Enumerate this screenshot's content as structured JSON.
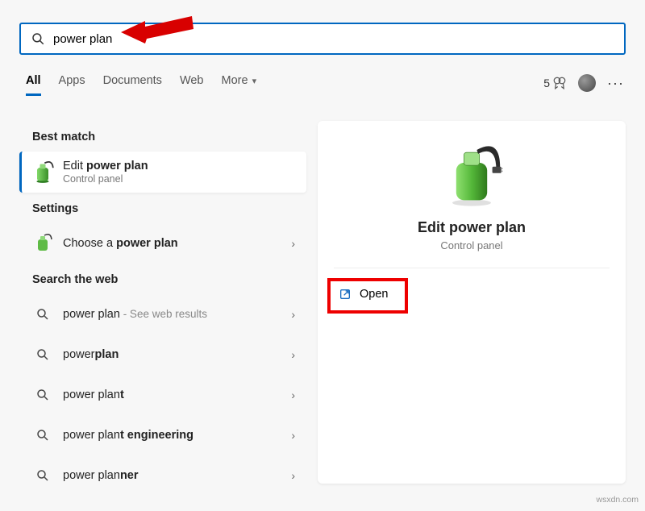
{
  "search": {
    "value": "power plan"
  },
  "tabs": {
    "all": "All",
    "apps": "Apps",
    "documents": "Documents",
    "web": "Web",
    "more": "More"
  },
  "rewards": {
    "count": "5"
  },
  "sections": {
    "best_match": "Best match",
    "settings": "Settings",
    "web": "Search the web"
  },
  "best": {
    "title_pre": "Edit ",
    "title_bold": "power plan",
    "sub": "Control panel"
  },
  "setting": {
    "pre": "Choose a ",
    "bold": "power plan"
  },
  "web_items": [
    {
      "pre": "power plan",
      "bold": "",
      "suffix": " - See web results"
    },
    {
      "pre": "power",
      "bold": "plan",
      "suffix": ""
    },
    {
      "pre": "power plan",
      "bold": "t",
      "suffix": ""
    },
    {
      "pre": "power plan",
      "bold": "t engineering",
      "suffix": ""
    },
    {
      "pre": "power plan",
      "bold": "ner",
      "suffix": ""
    }
  ],
  "detail": {
    "title": "Edit power plan",
    "sub": "Control panel",
    "open": "Open"
  },
  "watermark": "wsxdn.com"
}
